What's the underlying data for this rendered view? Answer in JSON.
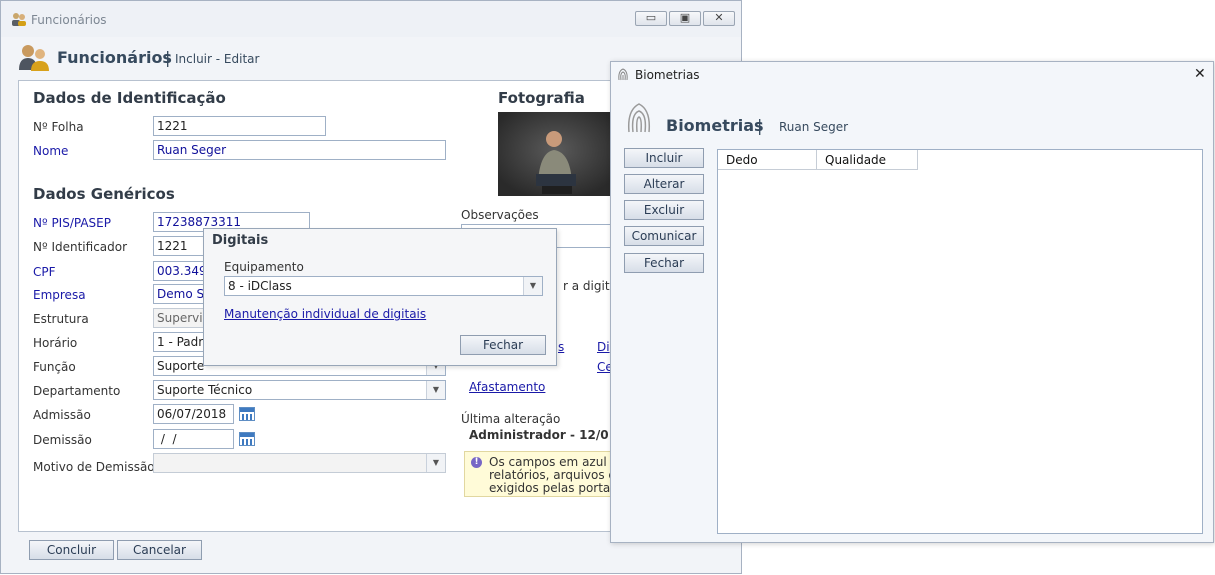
{
  "main_window": {
    "title": "Funcionários",
    "header_title": "Funcionários",
    "header_separator": "|",
    "header_subtitle": "Incluir - Editar",
    "controls": {
      "minimize": "▭",
      "restore": "▣",
      "close": "✕"
    }
  },
  "identificacao": {
    "heading": "Dados de Identificação",
    "folha_label": "Nº Folha",
    "folha_value": "1221",
    "nome_label": "Nome",
    "nome_value": "Ruan Seger"
  },
  "genericos": {
    "heading": "Dados Genéricos",
    "pis_label": "Nº PIS/PASEP",
    "pis_value": "17238873311",
    "identificador_label": "Nº Identificador",
    "identificador_value": "1221",
    "cpf_label": "CPF",
    "cpf_value": "003.349.",
    "empresa_label": "Empresa",
    "empresa_value": "Demo Se",
    "estrutura_label": "Estrutura",
    "estrutura_value": "Supervis",
    "horario_label": "Horário",
    "horario_value": "1 - Padrã",
    "funcao_label": "Função",
    "funcao_value": "Suporte",
    "departamento_label": "Departamento",
    "departamento_value": "Suporte Técnico",
    "admissao_label": "Admissão",
    "admissao_value": "06/07/2018",
    "demissao_label": "Demissão",
    "demissao_value": " /  /",
    "motivo_label": "Motivo de Demissão",
    "motivo_value": ""
  },
  "foto": {
    "heading": "Fotografia"
  },
  "right_col": {
    "observacoes_label": "Observações",
    "digital_text": "r a digital",
    "link_s": "s",
    "link_di": "Di",
    "link_ce": "Ce",
    "afastamento_link": "Afastamento",
    "ultima_label": "Última alteração",
    "ultima_value": "Administrador - 12/0",
    "info_line1": "Os campos em azul s",
    "info_line2": "relatórios, arquivos e",
    "info_line3": "exigidos pelas portari"
  },
  "footer": {
    "concluir": "Concluir",
    "cancelar": "Cancelar"
  },
  "digitais": {
    "title": "Digitais",
    "equipamento_label": "Equipamento",
    "equipamento_value": "8 - iDClass",
    "manutencao_link": "Manutenção individual de digitais",
    "fechar": "Fechar"
  },
  "biometrias": {
    "window_title": "Biometrias",
    "header_title": "Biometrias",
    "header_separator": "|",
    "header_subtitle": "Ruan Seger",
    "close_glyph": "✕",
    "buttons": [
      "Incluir",
      "Alterar",
      "Excluir",
      "Comunicar",
      "Fechar"
    ],
    "table_columns": [
      "Dedo",
      "Qualidade"
    ]
  },
  "colors": {
    "accent_blue": "#1a1aa8",
    "panel_bg": "#f2f4f8",
    "info_bg": "#fffbd8"
  }
}
